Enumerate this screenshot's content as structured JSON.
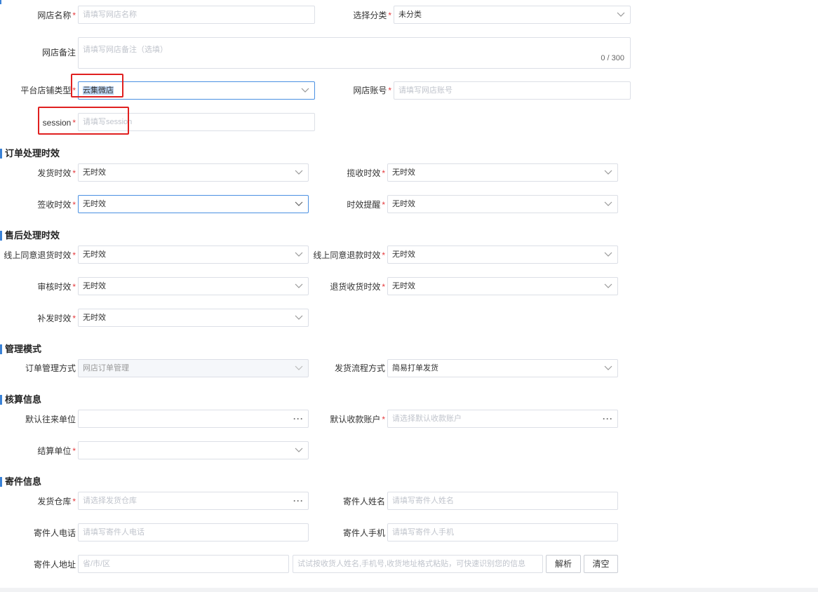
{
  "basic": {
    "shop_name_label": "网店名称",
    "shop_name_placeholder": "请填写网店名称",
    "category_label": "选择分类",
    "category_value": "未分类",
    "remark_label": "网店备注",
    "remark_placeholder": "请填写网店备注（选填）",
    "remark_counter": "0 / 300",
    "platform_type_label": "平台店铺类型",
    "platform_type_value": "云集微店",
    "account_label": "网店账号",
    "account_placeholder": "请填写网店账号",
    "session_label": "session",
    "session_placeholder": "请填写session"
  },
  "order_timing": {
    "title": "订单处理时效",
    "ship_label": "发货时效",
    "ship_value": "无时效",
    "pickup_label": "揽收时效",
    "pickup_value": "无时效",
    "sign_label": "签收时效",
    "sign_value": "无时效",
    "remind_label": "时效提醒",
    "remind_value": "无时效"
  },
  "aftersale": {
    "title": "售后处理时效",
    "return_goods_label": "线上同意退货时效",
    "return_goods_value": "无时效",
    "refund_label": "线上同意退款时效",
    "refund_value": "无时效",
    "audit_label": "审核时效",
    "audit_value": "无时效",
    "return_receive_label": "退货收货时效",
    "return_receive_value": "无时效",
    "reissue_label": "补发时效",
    "reissue_value": "无时效"
  },
  "management": {
    "title": "管理模式",
    "order_mode_label": "订单管理方式",
    "order_mode_value": "网店订单管理",
    "flow_label": "发货流程方式",
    "flow_value": "简易打单发货"
  },
  "accounting": {
    "title": "核算信息",
    "default_unit_label": "默认往来单位",
    "default_account_label": "默认收款账户",
    "default_account_placeholder": "请选择默认收款账户",
    "settle_label": "结算单位"
  },
  "sender": {
    "title": "寄件信息",
    "warehouse_label": "发货仓库",
    "warehouse_placeholder": "请选择发货仓库",
    "name_label": "寄件人姓名",
    "name_placeholder": "请填写寄件人姓名",
    "phone_label": "寄件人电话",
    "phone_placeholder": "请填写寄件人电话",
    "mobile_label": "寄件人手机",
    "mobile_placeholder": "请填写寄件人手机",
    "address_label": "寄件人地址",
    "region_placeholder": "省/市/区",
    "parse_placeholder": "试试按收货人姓名,手机号,收货地址格式粘贴，可快速识别您的信息",
    "parse_button": "解析",
    "clear_button": "清空"
  },
  "required_mark": "*",
  "more_dots": "···",
  "accent_color": "#3b82d6",
  "annotation_color": "#e02020"
}
